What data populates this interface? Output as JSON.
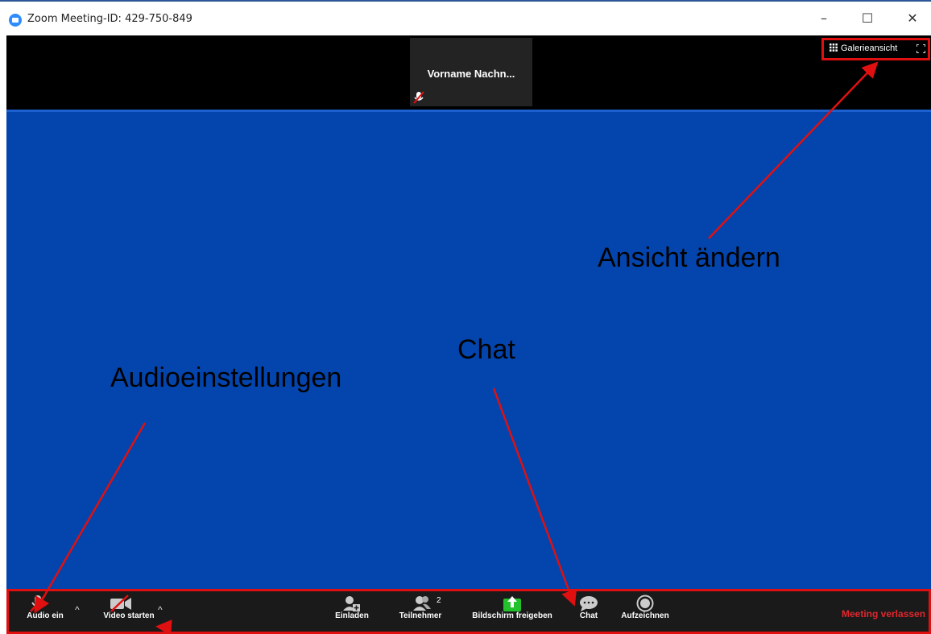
{
  "window": {
    "title": "Zoom Meeting-ID: 429-750-849",
    "minimize_icon": "minimize-icon",
    "maximize_icon": "maximize-icon",
    "close_icon": "close-icon"
  },
  "participant_thumb": {
    "name": "Vorname Nachn..."
  },
  "view_controls": {
    "gallery_label": "Galerieansicht"
  },
  "annotations": {
    "view_change": "Ansicht ändern",
    "chat": "Chat",
    "audio_settings": "Audioeinstellungen"
  },
  "toolbar": {
    "audio_label": "Audio ein",
    "video_label": "Video starten",
    "invite_label": "Einladen",
    "participants_label": "Teilnehmer",
    "participants_count": "2",
    "share_label": "Bildschirm freigeben",
    "chat_label": "Chat",
    "record_label": "Aufzeichnen",
    "leave_label": "Meeting verlassen"
  },
  "colors": {
    "accent_blue": "#0345ad",
    "annotation_red": "#e01010",
    "share_green": "#23c12b",
    "leave_red": "#e0282e"
  }
}
